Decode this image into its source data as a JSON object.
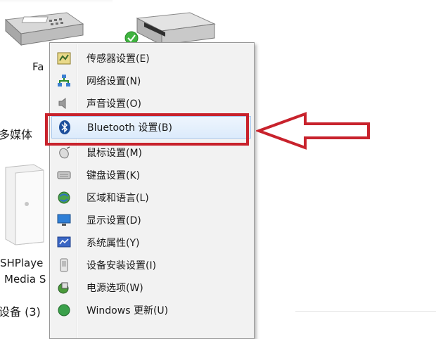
{
  "background": {
    "fax_label": "Fa",
    "multimedia_heading": "多媒体",
    "device_label_line1": "SHPlaye",
    "device_label_line2": "Media S",
    "devices_section_heading": "设备 (3)"
  },
  "context_menu": {
    "items": [
      {
        "label": "传感器设置(E)",
        "icon": "sensor-settings-icon"
      },
      {
        "label": "网络设置(N)",
        "icon": "network-settings-icon"
      },
      {
        "label": "声音设置(O)",
        "icon": "sound-settings-icon"
      },
      {
        "label": "Bluetooth 设置(B)",
        "icon": "bluetooth-icon"
      },
      {
        "label": "鼠标设置(M)",
        "icon": "mouse-settings-icon"
      },
      {
        "label": "键盘设置(K)",
        "icon": "keyboard-settings-icon"
      },
      {
        "label": "区域和语言(L)",
        "icon": "region-language-icon"
      },
      {
        "label": "显示设置(D)",
        "icon": "display-settings-icon"
      },
      {
        "label": "系统属性(Y)",
        "icon": "system-properties-icon"
      },
      {
        "label": "设备安装设置(I)",
        "icon": "device-install-icon"
      },
      {
        "label": "电源选项(W)",
        "icon": "power-options-icon"
      },
      {
        "label": "Windows 更新(U)",
        "icon": "windows-update-icon"
      }
    ]
  },
  "colors": {
    "highlight_border": "#c8222c",
    "arrow_color": "#c8222c"
  }
}
